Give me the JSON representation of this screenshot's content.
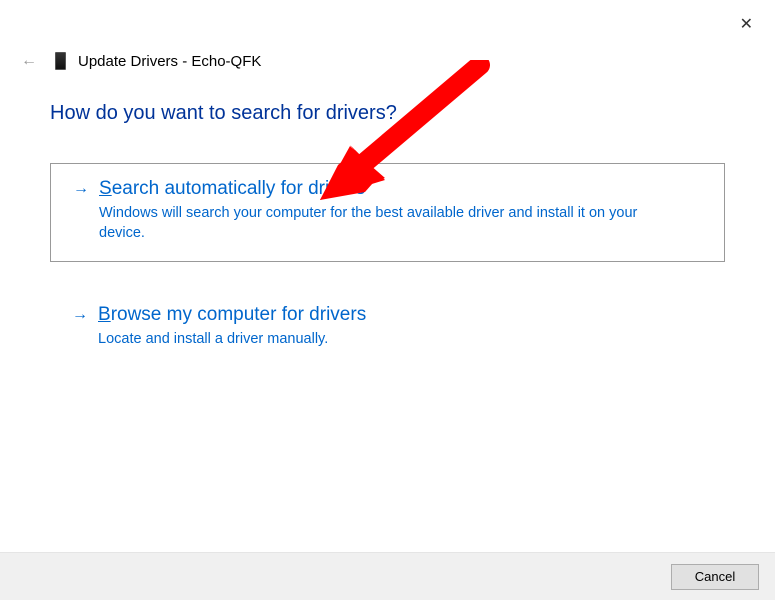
{
  "header": {
    "title": "Update Drivers - Echo-QFK"
  },
  "prompt": "How do you want to search for drivers?",
  "options": [
    {
      "title_prefix": "S",
      "title_rest": "earch automatically for drivers",
      "desc": "Windows will search your computer for the best available driver and install it on your device."
    },
    {
      "title_prefix": "B",
      "title_rest": "rowse my computer for drivers",
      "desc": "Locate and install a driver manually."
    }
  ],
  "footer": {
    "cancel": "Cancel"
  }
}
